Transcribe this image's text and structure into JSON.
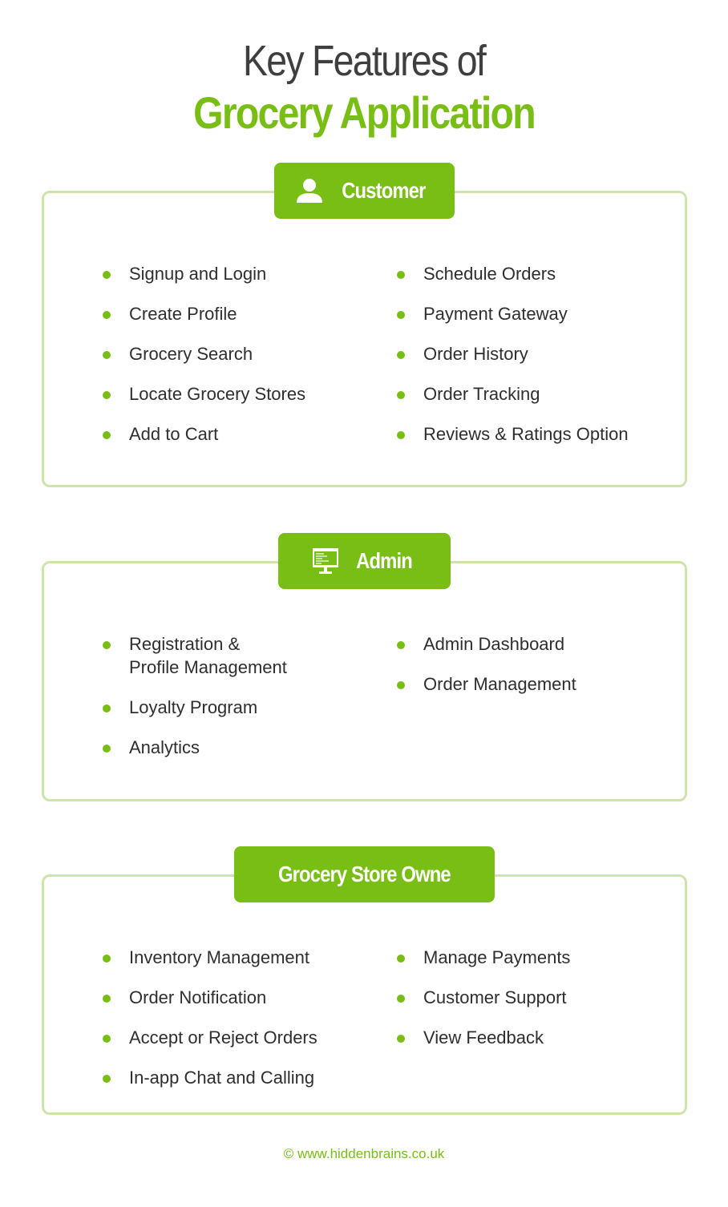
{
  "title": {
    "line1": "Key Features of",
    "line2": "Grocery Application"
  },
  "colors": {
    "accent": "#78be14",
    "border": "#cde5ad",
    "text": "#2e2e2e",
    "title": "#3f3f3f"
  },
  "sections": [
    {
      "label": "Customer",
      "icon": "user-icon",
      "left": [
        "Signup and Login",
        "Create Profile",
        "Grocery Search",
        "Locate Grocery Stores",
        "Add to Cart"
      ],
      "right": [
        "Schedule Orders",
        "Payment Gateway",
        "Order History",
        "Order Tracking",
        "Reviews & Ratings Option"
      ]
    },
    {
      "label": "Admin",
      "icon": "monitor-icon",
      "left": [
        "Registration &\nProfile Management",
        "Loyalty Program",
        "Analytics"
      ],
      "right": [
        "Admin Dashboard",
        "Order Management"
      ]
    },
    {
      "label": "Grocery Store Owne",
      "icon": "",
      "left": [
        "Inventory Management",
        "Order Notification",
        "Accept or Reject Orders",
        "In-app Chat and Calling"
      ],
      "right": [
        "Manage Payments",
        "Customer Support",
        "View Feedback"
      ]
    }
  ],
  "footer": "© www.hiddenbrains.co.uk"
}
